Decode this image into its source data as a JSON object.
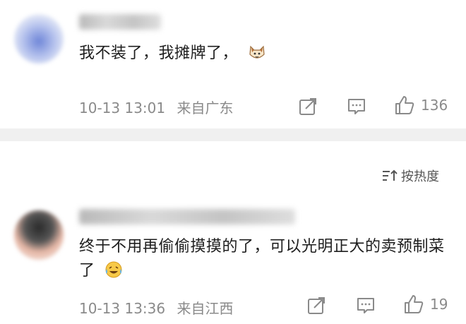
{
  "comments": [
    {
      "text": "我不装了，我摊牌了，",
      "emoji": "cat-face-emoji",
      "time": "10-13 13:01",
      "location": "来自广东",
      "likes": "136"
    },
    {
      "text": "终于不用再偷偷摸摸的了，可以光明正大的卖预制菜了",
      "emoji": "laughing-crying-emoji",
      "time": "10-13 13:36",
      "location": "来自江西",
      "likes": "19"
    }
  ],
  "sort": {
    "label": "按热度"
  },
  "colors": {
    "meta": "#8a8a8a",
    "divider": "#f0f0f0"
  }
}
